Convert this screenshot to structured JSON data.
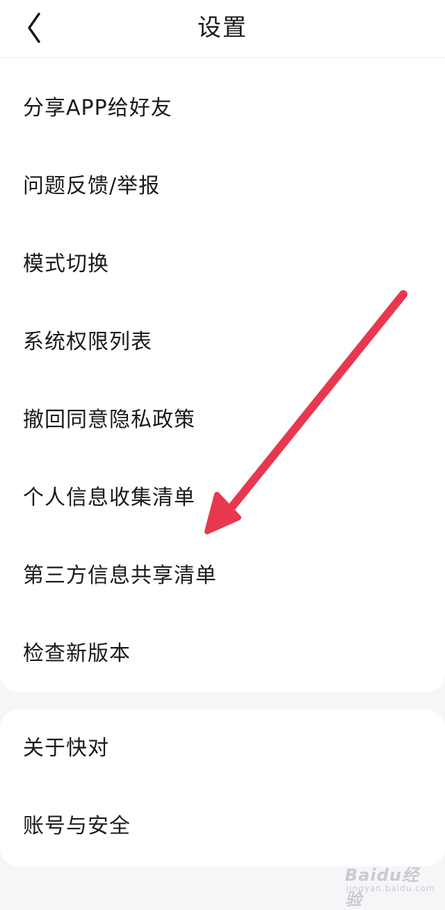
{
  "header": {
    "back_icon": "chevron-left-icon",
    "title": "设置"
  },
  "group1": {
    "items": [
      {
        "label": "分享APP给好友"
      },
      {
        "label": "问题反馈/举报"
      },
      {
        "label": "模式切换"
      },
      {
        "label": "系统权限列表"
      },
      {
        "label": "撤回同意隐私政策"
      },
      {
        "label": "个人信息收集清单"
      },
      {
        "label": "第三方信息共享清单"
      },
      {
        "label": "检查新版本"
      }
    ]
  },
  "group2": {
    "items": [
      {
        "label": "关于快对"
      },
      {
        "label": "账号与安全"
      }
    ]
  },
  "annotation": {
    "type": "arrow",
    "color": "#e8384f"
  },
  "watermark": {
    "logo": "Baidu经验",
    "sub": "jingyan.baidu.com"
  },
  "colors": {
    "background": "#f5f6f8",
    "card": "#ffffff",
    "text": "#1a1a1a"
  }
}
